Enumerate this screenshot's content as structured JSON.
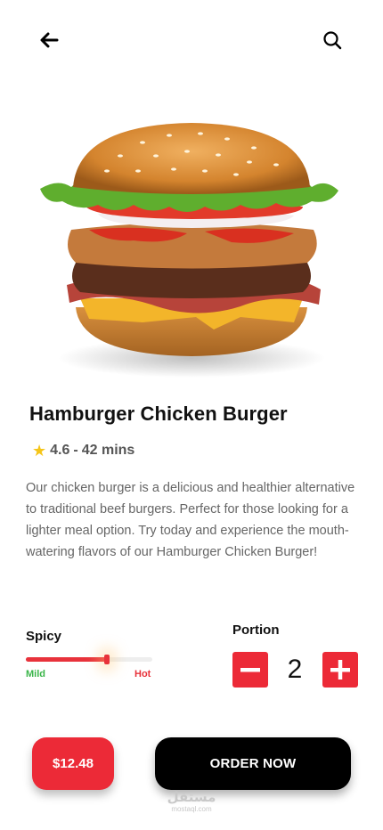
{
  "header": {
    "back_icon": "arrow-left-icon",
    "search_icon": "search-icon"
  },
  "product": {
    "image_icon": "burger-image",
    "title": "Hamburger Chicken Burger",
    "rating": "4.6",
    "separator": "-",
    "time": "42 mins",
    "description": "Our chicken burger is a delicious and healthier alternative to traditional beef burgers. Perfect for those looking for a lighter meal option. Try today and experience the mouth-watering flavors of our Hamburger Chicken Burger!"
  },
  "spicy": {
    "label": "Spicy",
    "min_label": "Mild",
    "max_label": "Hot",
    "level": 0.64
  },
  "portion": {
    "label": "Portion",
    "value": "2"
  },
  "footer": {
    "price": "$12.48",
    "order_label": "ORDER NOW"
  },
  "watermark": {
    "main": "مستقل",
    "sub": "mostaql.com"
  },
  "colors": {
    "accent": "#EC2A37",
    "star": "#F5C518",
    "mild": "#3BB54A",
    "dark": "#000000"
  }
}
